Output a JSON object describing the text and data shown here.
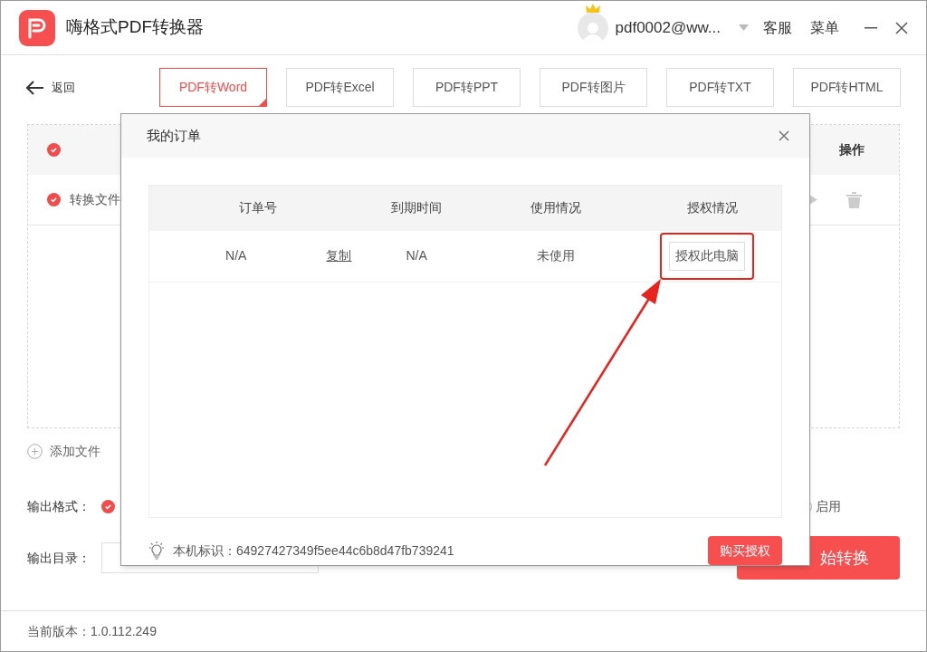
{
  "window": {
    "title": "嗨格式PDF转换器",
    "user": "pdf0002@ww...",
    "links": [
      "客服",
      "菜单"
    ]
  },
  "back": "返回",
  "tabs": [
    {
      "label": "PDF转Word",
      "selected": true
    },
    {
      "label": "PDF转Excel",
      "selected": false
    },
    {
      "label": "PDF转PPT",
      "selected": false
    },
    {
      "label": "PDF转图片",
      "selected": false
    },
    {
      "label": "PDF转TXT",
      "selected": false
    },
    {
      "label": "PDF转HTML",
      "selected": false
    }
  ],
  "file_list": {
    "header_checked": true,
    "action_column": "操作",
    "rows": [
      {
        "name": "转换文件",
        "checked": true
      }
    ]
  },
  "add_file": "添加文件",
  "output_format": {
    "label": "输出格式：",
    "checked": true
  },
  "option": {
    "label": "启用",
    "selected": false
  },
  "output_dir": {
    "label": "输出目录："
  },
  "start_button": "始转换",
  "version": "当前版本：1.0.112.249",
  "dialog": {
    "title": "我的订单",
    "columns": [
      "订单号",
      "到期时间",
      "使用情况",
      "授权情况"
    ],
    "rows": [
      {
        "order_no": "N/A",
        "copy": "复制",
        "expires": "N/A",
        "usage": "未使用",
        "action": "授权此电脑",
        "highlighted": true
      }
    ],
    "machine_id": "本机标识：64927427349f5ee44c6b8d47fb739241",
    "buy_button": "购买授权"
  }
}
